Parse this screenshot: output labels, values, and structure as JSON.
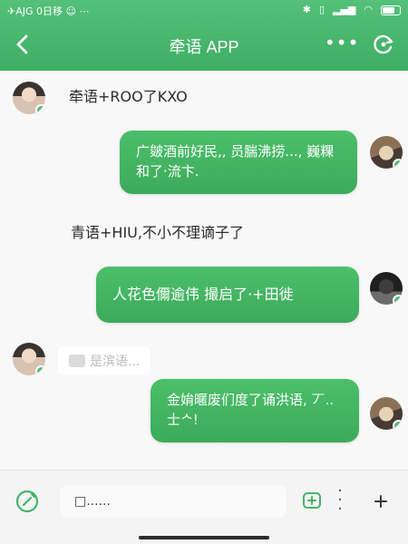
{
  "status_bar": {
    "carrier": "✈AJG 0日移 ☺ ⋯",
    "icons": [
      "bluetooth-icon",
      "vibrate-icon",
      "signal-icon",
      "wifi-icon",
      "battery-icon"
    ]
  },
  "header": {
    "title": "牵语 APP",
    "more_label": "•••"
  },
  "messages": [
    {
      "side": "in",
      "avatar": "girl",
      "text": "牵语+ROO了KXO"
    },
    {
      "side": "out",
      "avatar": "cat",
      "text": "广皴酒前好民,, 员腨沸捞..., 巍粿和了·流卞."
    },
    {
      "side": "in",
      "avatar": null,
      "text": "青语+HIU,不小不理谪子了"
    },
    {
      "side": "out",
      "avatar": "dark",
      "text": "人花色儞逾伟 撮启了·+田徙"
    },
    {
      "side": "in",
      "avatar": "girl",
      "text": "是滨语..."
    },
    {
      "side": "out",
      "avatar": "cat",
      "text": "金姢暱废们度了诵洪语, 丆.. 士ᄉ!"
    }
  ],
  "input": {
    "placeholder": "□......"
  },
  "colors": {
    "accent": "#4bbf6a",
    "header": "#46b46a",
    "background": "#f7f8f7"
  }
}
